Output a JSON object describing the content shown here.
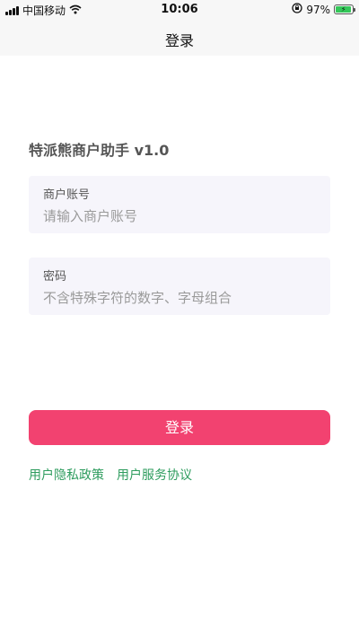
{
  "status_bar": {
    "carrier": "中国移动",
    "time": "10:06",
    "battery": "97%",
    "icons": [
      "signal-icon",
      "wifi-icon",
      "rotation-lock-icon",
      "battery-icon"
    ]
  },
  "nav": {
    "title": "登录"
  },
  "app": {
    "title": "特派熊商户助手 v1.0"
  },
  "account": {
    "label": "商户账号",
    "placeholder": "请输入商户账号",
    "value": ""
  },
  "password": {
    "label": "密码",
    "placeholder": "不含特殊字符的数字、字母组合",
    "value": ""
  },
  "login_button": {
    "label": "登录"
  },
  "links": {
    "privacy": "用户隐私政策",
    "service": "用户服务协议"
  },
  "colors": {
    "accent": "#f24270",
    "link": "#2e9c5e",
    "field_bg": "#f6f5fb"
  }
}
